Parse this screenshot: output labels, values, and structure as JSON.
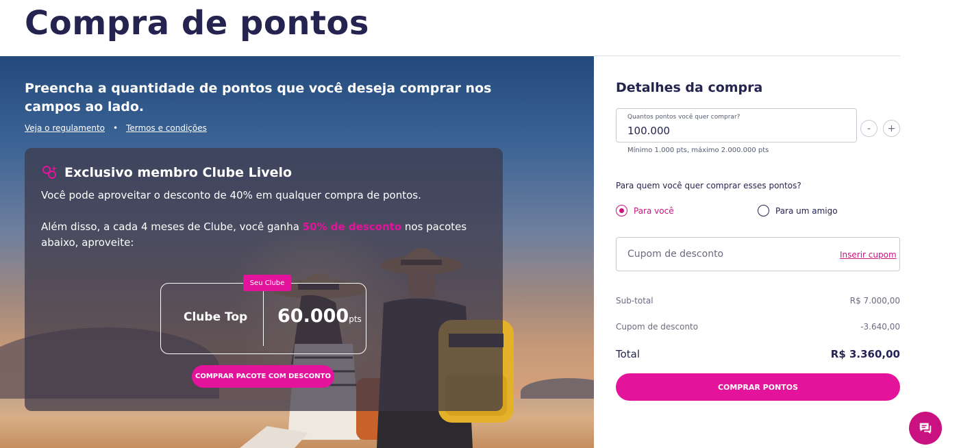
{
  "page": {
    "title": "Compra de pontos"
  },
  "hero": {
    "heading": "Preencha a quantidade de pontos que você deseja comprar nos campos ao lado.",
    "links": [
      "Veja o regulamento",
      "Termos e condições"
    ],
    "separator": "•"
  },
  "club": {
    "title": "Exclusivo membro Clube Livelo",
    "text1": "Você pode aproveitar o desconto de 40% em qualquer compra de pontos.",
    "text2_before": "Além disso, a cada 4 meses de Clube, você ganha ",
    "text2_highlight": "50% de desconto",
    "text2_after": " nos pacotes abaixo, aproveite:",
    "package": {
      "badge": "Seu Clube",
      "name": "Clube Top",
      "points": "60.000",
      "unit": "pts",
      "button": "COMPRAR PACOTE COM DESCONTO"
    }
  },
  "details": {
    "title": "Detalhes da compra",
    "quantity_label": "Quantos pontos você quer comprar?",
    "quantity_value": "100.000",
    "minus": "-",
    "plus": "+",
    "quantity_hint": "Mínimo 1.000 pts, máximo 2.000.000 pts",
    "who_question": "Para quem você quer comprar esses pontos?",
    "options": [
      {
        "label": "Para você",
        "selected": true
      },
      {
        "label": "Para um amigo",
        "selected": false
      }
    ],
    "coupon_placeholder": "Cupom de desconto",
    "coupon_link": "Inserir cupom",
    "summary": {
      "subtotal_label": "Sub-total",
      "subtotal_value": "R$ 7.000,00",
      "coupon_label": "Cupom de desconto",
      "coupon_value": "-3.640,00",
      "total_label": "Total",
      "total_value": "R$ 3.360,00"
    },
    "buy_button": "COMPRAR PONTOS"
  },
  "colors": {
    "brand_pink": "#e3139b",
    "navy": "#252350"
  },
  "icons": {
    "club": "club-sparkle-icon",
    "chat": "chat-icon"
  }
}
